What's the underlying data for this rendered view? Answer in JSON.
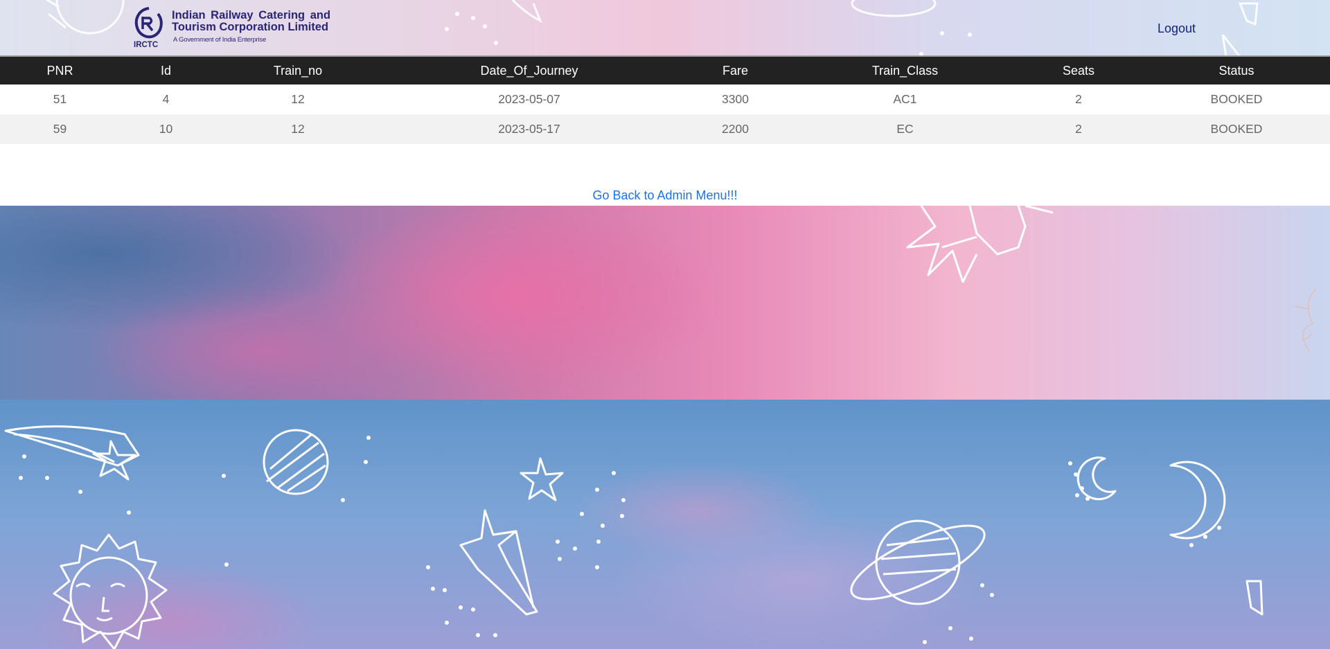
{
  "header": {
    "org_line1": "Indian Railway Catering and",
    "org_line2": "Tourism Corporation Limited",
    "org_sub": "A Government of India Enterprise",
    "logo_text": "IRCTC",
    "logout_label": "Logout"
  },
  "table": {
    "columns": [
      "PNR",
      "Id",
      "Train_no",
      "Date_Of_Journey",
      "Fare",
      "Train_Class",
      "Seats",
      "Status"
    ],
    "rows": [
      [
        "51",
        "4",
        "12",
        "2023-05-07",
        "3300",
        "AC1",
        "2",
        "BOOKED"
      ],
      [
        "59",
        "10",
        "12",
        "2023-05-17",
        "2200",
        "EC",
        "2",
        "BOOKED"
      ]
    ]
  },
  "links": {
    "back_label": "Go Back to Admin Menu!!!"
  },
  "colors": {
    "brand": "#2a2577",
    "header_row": "#222222",
    "link": "#1a73e8"
  }
}
